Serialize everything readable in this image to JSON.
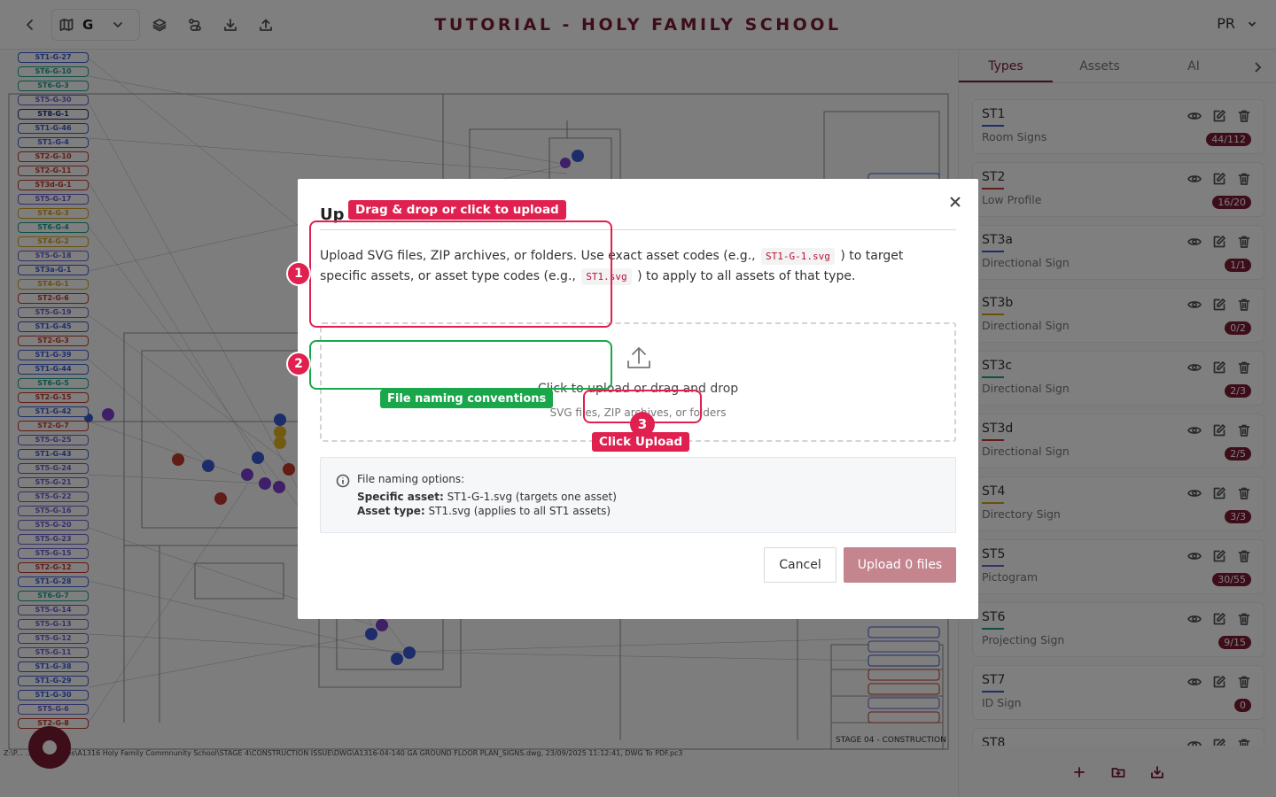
{
  "header": {
    "title": "TUTORIAL - HOLY FAMILY SCHOOL",
    "floor": "G",
    "user_initials": "PR"
  },
  "canvas": {
    "sign_tags": [
      {
        "code": "ST1-G-27",
        "color": "#3b5bd6"
      },
      {
        "code": "ST6-G-10",
        "color": "#1b9e8c"
      },
      {
        "code": "ST6-G-3",
        "color": "#1b9e8c"
      },
      {
        "code": "ST5-G-30",
        "color": "#6a5fd0"
      },
      {
        "code": "ST8-G-1",
        "color": "#1d2c7a"
      },
      {
        "code": "ST1-G-46",
        "color": "#3b5bd6"
      },
      {
        "code": "ST1-G-4",
        "color": "#3b5bd6"
      },
      {
        "code": "ST2-G-10",
        "color": "#c0392b"
      },
      {
        "code": "ST2-G-11",
        "color": "#c0392b"
      },
      {
        "code": "ST3d-G-1",
        "color": "#c0392b"
      },
      {
        "code": "ST5-G-17",
        "color": "#6a5fd0"
      },
      {
        "code": "ST4-G-3",
        "color": "#d4a017"
      },
      {
        "code": "ST6-G-4",
        "color": "#1b9e8c"
      },
      {
        "code": "ST4-G-2",
        "color": "#d4a017"
      },
      {
        "code": "ST5-G-18",
        "color": "#6a5fd0"
      },
      {
        "code": "ST3a-G-1",
        "color": "#3b5bd6"
      },
      {
        "code": "ST4-G-1",
        "color": "#d4a017"
      },
      {
        "code": "ST2-G-6",
        "color": "#c0392b"
      },
      {
        "code": "ST5-G-19",
        "color": "#6a5fd0"
      },
      {
        "code": "ST1-G-45",
        "color": "#3b5bd6"
      },
      {
        "code": "ST2-G-3",
        "color": "#c0392b"
      },
      {
        "code": "ST1-G-39",
        "color": "#3b5bd6"
      },
      {
        "code": "ST1-G-44",
        "color": "#3b5bd6"
      },
      {
        "code": "ST6-G-5",
        "color": "#1b9e8c"
      },
      {
        "code": "ST2-G-15",
        "color": "#c0392b"
      },
      {
        "code": "ST1-G-42",
        "color": "#3b5bd6"
      },
      {
        "code": "ST2-G-7",
        "color": "#c0392b"
      },
      {
        "code": "ST5-G-25",
        "color": "#6a5fd0"
      },
      {
        "code": "ST1-G-43",
        "color": "#3b5bd6"
      },
      {
        "code": "ST5-G-24",
        "color": "#6a5fd0"
      },
      {
        "code": "ST5-G-21",
        "color": "#6a5fd0"
      },
      {
        "code": "ST5-G-22",
        "color": "#6a5fd0"
      },
      {
        "code": "ST5-G-16",
        "color": "#6a5fd0"
      },
      {
        "code": "ST5-G-20",
        "color": "#6a5fd0"
      },
      {
        "code": "ST5-G-23",
        "color": "#6a5fd0"
      },
      {
        "code": "ST5-G-15",
        "color": "#6a5fd0"
      },
      {
        "code": "ST2-G-12",
        "color": "#c0392b"
      },
      {
        "code": "ST1-G-28",
        "color": "#3b5bd6"
      },
      {
        "code": "ST6-G-7",
        "color": "#1b9e8c"
      },
      {
        "code": "ST5-G-14",
        "color": "#6a5fd0"
      },
      {
        "code": "ST5-G-13",
        "color": "#6a5fd0"
      },
      {
        "code": "ST5-G-12",
        "color": "#6a5fd0"
      },
      {
        "code": "ST5-G-11",
        "color": "#6a5fd0"
      },
      {
        "code": "ST1-G-38",
        "color": "#3b5bd6"
      },
      {
        "code": "ST1-G-29",
        "color": "#3b5bd6"
      },
      {
        "code": "ST1-G-30",
        "color": "#3b5bd6"
      },
      {
        "code": "ST5-G-6",
        "color": "#6a5fd0"
      },
      {
        "code": "ST2-G-8",
        "color": "#c0392b"
      }
    ],
    "footer_path": "Z:\\P... ...TS\\A13 Files\\A1316 Holy Family Commnunity School\\STAGE 4\\CONSTRUCTION ISSUE\\DWG\\A1316-04-140 GA GROUND FLOOR PLAN_SIGNS.dwg, 23/09/2025 11:12:41, DWG To PDF.pc3",
    "title_block_stage": "STAGE 04 - CONSTRUCTION"
  },
  "panel": {
    "tabs": [
      "Types",
      "Assets",
      "AI"
    ],
    "types": [
      {
        "code": "ST1",
        "name": "Room Signs",
        "count": "44/112",
        "color": "#3b5bd6"
      },
      {
        "code": "ST2",
        "name": "Low Profile",
        "count": "16/20",
        "color": "#c0392b"
      },
      {
        "code": "ST3a",
        "name": "Directional Sign",
        "count": "1/1",
        "color": "#3b5bd6"
      },
      {
        "code": "ST3b",
        "name": "Directional Sign",
        "count": "0/2",
        "color": "#d4a017"
      },
      {
        "code": "ST3c",
        "name": "Directional Sign",
        "count": "2/3",
        "color": "#1b9e8c"
      },
      {
        "code": "ST3d",
        "name": "Directional Sign",
        "count": "2/5",
        "color": "#c0392b"
      },
      {
        "code": "ST4",
        "name": "Directory Sign",
        "count": "3/3",
        "color": "#d4a017"
      },
      {
        "code": "ST5",
        "name": "Pictogram",
        "count": "30/55",
        "color": "#6a5fd0"
      },
      {
        "code": "ST6",
        "name": "Projecting Sign",
        "count": "9/15",
        "color": "#1b9e8c"
      },
      {
        "code": "ST7",
        "name": "ID Sign",
        "count": "0",
        "color": "#3b5bd6"
      },
      {
        "code": "ST8",
        "name": "",
        "count": "",
        "color": "#1d2c7a"
      }
    ]
  },
  "modal": {
    "title": "Up",
    "desc_1": "Upload SVG files, ZIP archives, or folders. Use exact asset codes (e.g.,",
    "code_1": "ST1-G-1.svg",
    "desc_2": ") to target specific assets, or asset type codes (e.g.,",
    "code_2": "ST1.svg",
    "desc_3": ") to apply to all assets of that type.",
    "dropzone_main": "Click to upload or drag and drop",
    "dropzone_sub": "SVG files, ZIP archives, or folders",
    "info_title": "File naming options:",
    "info_specific_label": "Specific asset:",
    "info_specific_text": "ST1-G-1.svg (targets one asset)",
    "info_type_label": "Asset type:",
    "info_type_text": "ST1.svg (applies to all ST1 assets)",
    "cancel_label": "Cancel",
    "upload_label": "Upload 0 files"
  },
  "tutorial": {
    "step1_number": "1",
    "step1_label": "Drag & drop or click to upload",
    "step2_number": "2",
    "step2_label": "File naming conventions",
    "step3_number": "3",
    "step3_label": "Click Upload"
  },
  "colors": {
    "brand": "#7a1a33",
    "annotation_red": "#e0204f",
    "annotation_green": "#1aa64a",
    "upload_disabled": "#c4858f"
  }
}
